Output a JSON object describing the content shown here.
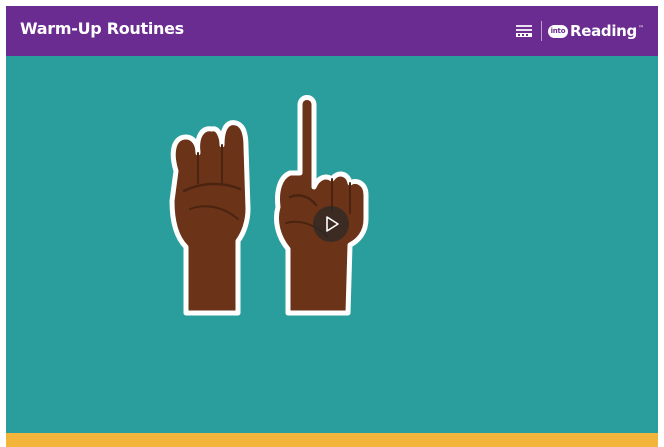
{
  "header": {
    "title": "Warm-Up Routines",
    "brand_name": "Reading",
    "brand_badge": "into",
    "trademark": "™",
    "background_color": "#6a2c91"
  },
  "stage": {
    "background_color": "#2a9e9c",
    "illustration": "fist-and-one-finger-hands",
    "play_icon": "play-icon"
  },
  "footer": {
    "accent_color": "#f2b43b"
  }
}
